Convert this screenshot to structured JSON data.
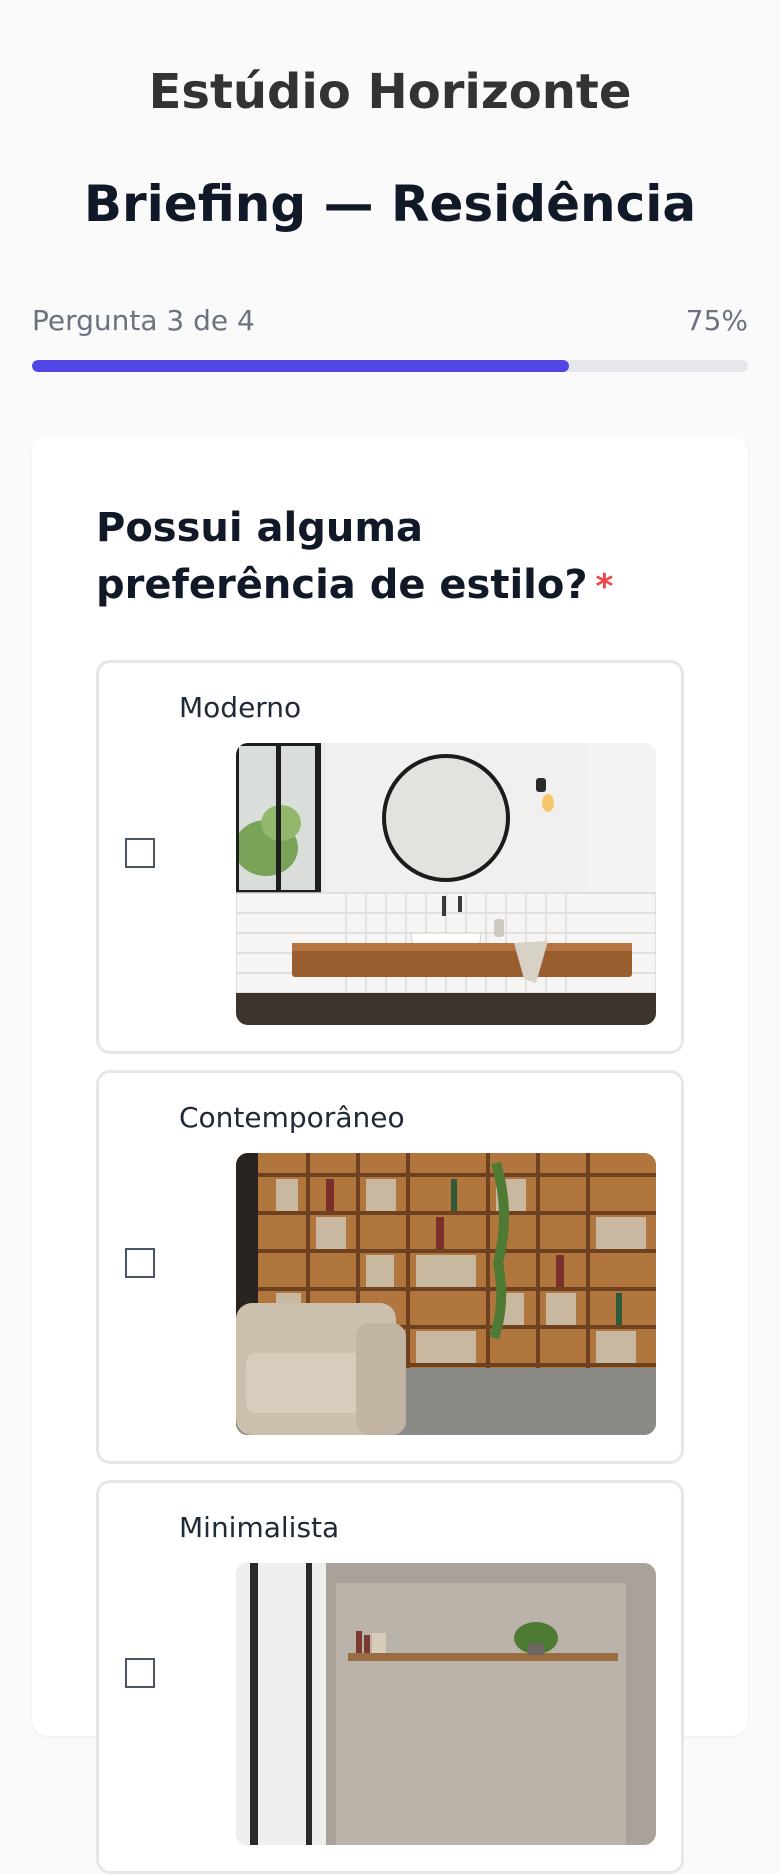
{
  "header": {
    "brand": "Estúdio Horizonte",
    "title": "Briefing — Residência"
  },
  "progress": {
    "label": "Pergunta 3 de 4",
    "percent_text": "75%",
    "fraction": 0.75
  },
  "question": {
    "text": "Possui alguma preferência de estilo?",
    "required_mark": "*"
  },
  "options": [
    {
      "label": "Moderno",
      "checked": false,
      "image": "modern-bathroom-photo"
    },
    {
      "label": "Contemporâneo",
      "checked": false,
      "image": "bookshelf-living-room-photo"
    },
    {
      "label": "Minimalista",
      "checked": false,
      "image": "minimalist-niche-photo"
    }
  ],
  "colors": {
    "accent": "#4f46e5",
    "required": "#ef4444",
    "track": "#e5e7eb"
  }
}
